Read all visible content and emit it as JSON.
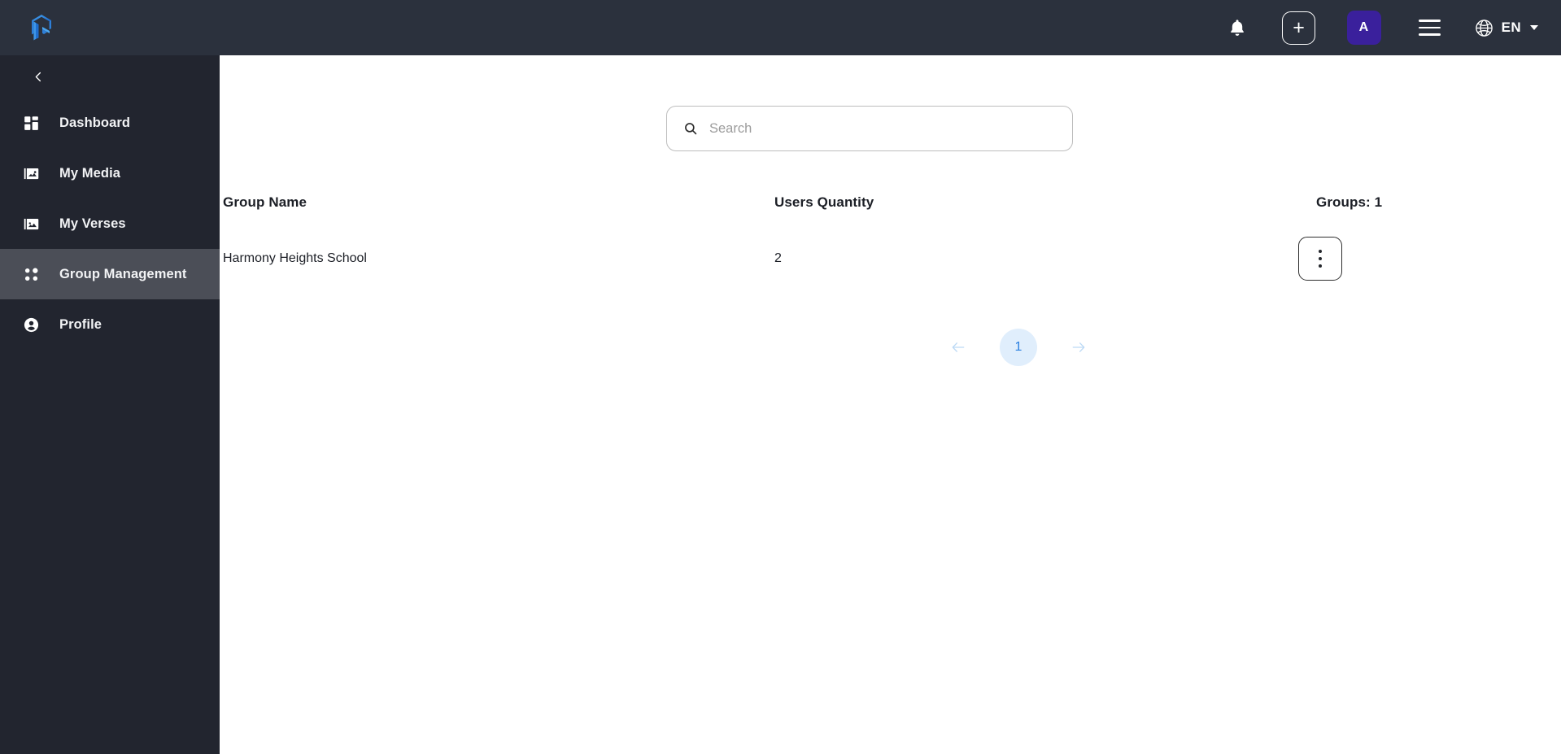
{
  "header": {
    "logo_icon": "cube-logo-icon",
    "notifications_icon": "bell-icon",
    "add_label": "+",
    "avatar_initial": "A",
    "avatar_color": "#3a209c",
    "menu_icon": "hamburger-menu-icon",
    "language_icon": "globe-icon",
    "language_code": "EN",
    "language_caret": "chevron-down-icon"
  },
  "sidebar": {
    "collapse_icon": "chevron-left-icon",
    "bg_color": "#22252f",
    "active_color": "#4b4e57",
    "items": [
      {
        "label": "Dashboard",
        "icon": "dashboard-grid-icon",
        "active": false
      },
      {
        "label": "My Media",
        "icon": "media-folder-icon",
        "active": false
      },
      {
        "label": "My Verses",
        "icon": "verses-image-icon",
        "active": false
      },
      {
        "label": "Group Management",
        "icon": "group-dots-icon",
        "active": true
      },
      {
        "label": "Profile",
        "icon": "user-circle-icon",
        "active": false
      }
    ]
  },
  "search": {
    "placeholder": "Search",
    "value": "",
    "icon": "search-icon"
  },
  "table": {
    "columns": {
      "group_name": "Group Name",
      "users_quantity": "Users Quantity",
      "groups_count": "Groups: 1"
    },
    "rows": [
      {
        "group_name": "Harmony Heights School",
        "users_quantity": "2",
        "actions_icon": "kebab-menu-icon"
      }
    ]
  },
  "pagination": {
    "prev_icon": "arrow-left-icon",
    "next_icon": "arrow-right-icon",
    "current_page": "1",
    "active_bg": "#e0eefc",
    "active_text_color": "#2a7fe0"
  }
}
